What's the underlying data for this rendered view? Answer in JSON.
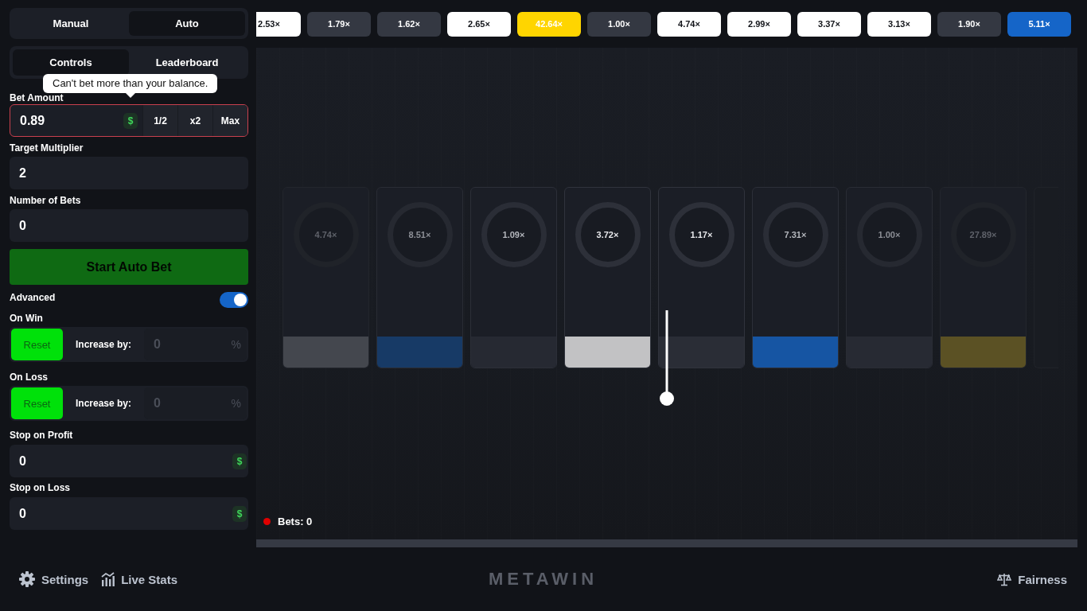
{
  "mode_tabs": [
    {
      "label": "Manual",
      "selected": false
    },
    {
      "label": "Auto",
      "selected": true
    }
  ],
  "panel_tabs": [
    {
      "label": "Controls",
      "selected": true
    },
    {
      "label": "Leaderboard",
      "selected": false
    }
  ],
  "tooltip": "Can't bet more than your balance.",
  "bet_amount": {
    "label": "Bet Amount",
    "value": "0.89",
    "currency": "$",
    "error": true,
    "buttons": [
      "1/2",
      "x2",
      "Max"
    ]
  },
  "target_multiplier": {
    "label": "Target Multiplier",
    "value": "2"
  },
  "number_of_bets": {
    "label": "Number of Bets",
    "value": "0"
  },
  "start_button": {
    "label": "Start Auto Bet",
    "disabled": true
  },
  "advanced": {
    "label": "Advanced",
    "on": true
  },
  "on_win": {
    "label": "On Win",
    "modes": [
      {
        "label": "Reset",
        "selected": true
      },
      {
        "label": "Increase by:",
        "selected": false
      }
    ],
    "value": "0",
    "unit": "%",
    "disabled": true
  },
  "on_loss": {
    "label": "On Loss",
    "modes": [
      {
        "label": "Reset",
        "selected": true
      },
      {
        "label": "Increase by:",
        "selected": false
      }
    ],
    "value": "0",
    "unit": "%",
    "disabled": true
  },
  "stop_on_profit": {
    "label": "Stop on Profit",
    "value": "0",
    "currency": "$"
  },
  "stop_on_loss": {
    "label": "Stop on Loss",
    "value": "0",
    "currency": "$"
  },
  "history": [
    {
      "text": "2.53×",
      "color": "#ffffff"
    },
    {
      "text": "1.79×",
      "color": "#343842"
    },
    {
      "text": "1.62×",
      "color": "#343842"
    },
    {
      "text": "2.65×",
      "color": "#ffffff"
    },
    {
      "text": "42.64×",
      "color": "#ffd500"
    },
    {
      "text": "1.00×",
      "color": "#343842"
    },
    {
      "text": "4.74×",
      "color": "#ffffff"
    },
    {
      "text": "2.99×",
      "color": "#ffffff"
    },
    {
      "text": "3.37×",
      "color": "#ffffff"
    },
    {
      "text": "3.13×",
      "color": "#ffffff"
    },
    {
      "text": "1.90×",
      "color": "#343842"
    },
    {
      "text": "5.11×",
      "color": "#1565c8"
    }
  ],
  "cards": [
    {
      "multiplier": "4.74×",
      "color": "#44474e"
    },
    {
      "multiplier": "8.51×",
      "color": "#173a66"
    },
    {
      "multiplier": "1.09×",
      "color": "#262932"
    },
    {
      "multiplier": "3.72×",
      "color": "#c2c2c4"
    },
    {
      "multiplier": "1.17×",
      "color": "#2a2d36"
    },
    {
      "multiplier": "7.31×",
      "color": "#1655a3"
    },
    {
      "multiplier": "1.00×",
      "color": "#272a33"
    },
    {
      "multiplier": "27.89×",
      "color": "#5b5124"
    }
  ],
  "bets": "Bets: 0",
  "footer": {
    "links": [
      "Settings",
      "Live Stats"
    ],
    "logo": "METAWIN",
    "fairness": "Fairness"
  }
}
